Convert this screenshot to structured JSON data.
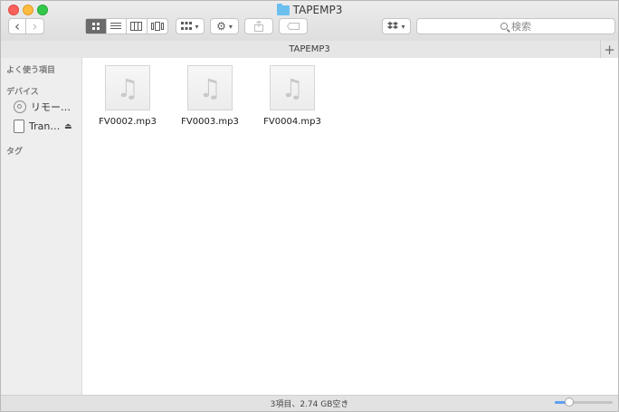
{
  "window": {
    "title": "TAPEMP3"
  },
  "toolbar": {
    "search_placeholder": "検索",
    "back_glyph": "‹",
    "forward_glyph": "›",
    "view_icons": [
      "icon-view-icon",
      "list-view-icon",
      "column-view-icon",
      "coverflow-view-icon"
    ]
  },
  "pathbar": {
    "label": "TAPEMP3",
    "plus": "+"
  },
  "sidebar": {
    "favorites_header": "よく使う項目",
    "devices_header": "デバイス",
    "devices": [
      {
        "label": "リモー…",
        "icon": "disc-icon"
      },
      {
        "label": "Tran…",
        "icon": "drive-icon"
      }
    ],
    "tags_header": "タグ"
  },
  "files": [
    {
      "name": "FV0002.mp3",
      "icon": "music-note-icon"
    },
    {
      "name": "FV0003.mp3",
      "icon": "music-note-icon"
    },
    {
      "name": "FV0004.mp3",
      "icon": "music-note-icon"
    }
  ],
  "status": {
    "text": "3項目、2.74 GB空き",
    "icon_size_slider": 0.2
  },
  "colors": {
    "accent": "#5ea0f5",
    "folder": "#6cc0f0"
  }
}
